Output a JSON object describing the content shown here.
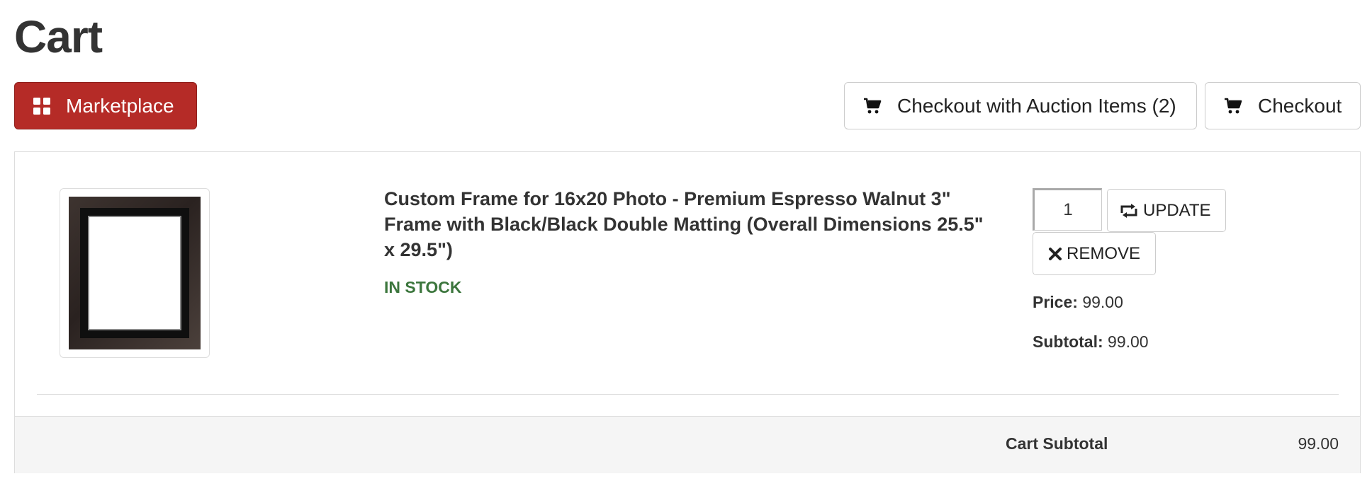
{
  "page": {
    "title": "Cart"
  },
  "toolbar": {
    "marketplace_label": "Marketplace",
    "auction_checkout_label": "Checkout with Auction Items (2)",
    "checkout_label": "Checkout"
  },
  "cart": {
    "items": [
      {
        "name": "Custom Frame for 16x20 Photo - Premium Espresso Walnut 3\" Frame with Black/Black Double Matting (Overall Dimensions 25.5\" x 29.5\")",
        "stock_status": "IN STOCK",
        "quantity": "1",
        "update_label": "UPDATE",
        "remove_label": "REMOVE",
        "price_label": "Price:",
        "price": "99.00",
        "subtotal_label": "Subtotal:",
        "subtotal": "99.00",
        "image_icon": "frame-thumbnail"
      }
    ],
    "footer": {
      "subtotal_label": "Cart Subtotal",
      "subtotal_value": "99.00"
    }
  },
  "colors": {
    "marketplace_button": "#b52b27",
    "in_stock": "#3c763d",
    "footer_background": "#f5f5f5"
  },
  "icons": {
    "marketplace": "grid-icon",
    "checkout": "cart-icon",
    "update": "refresh-icon",
    "remove": "close-icon"
  }
}
